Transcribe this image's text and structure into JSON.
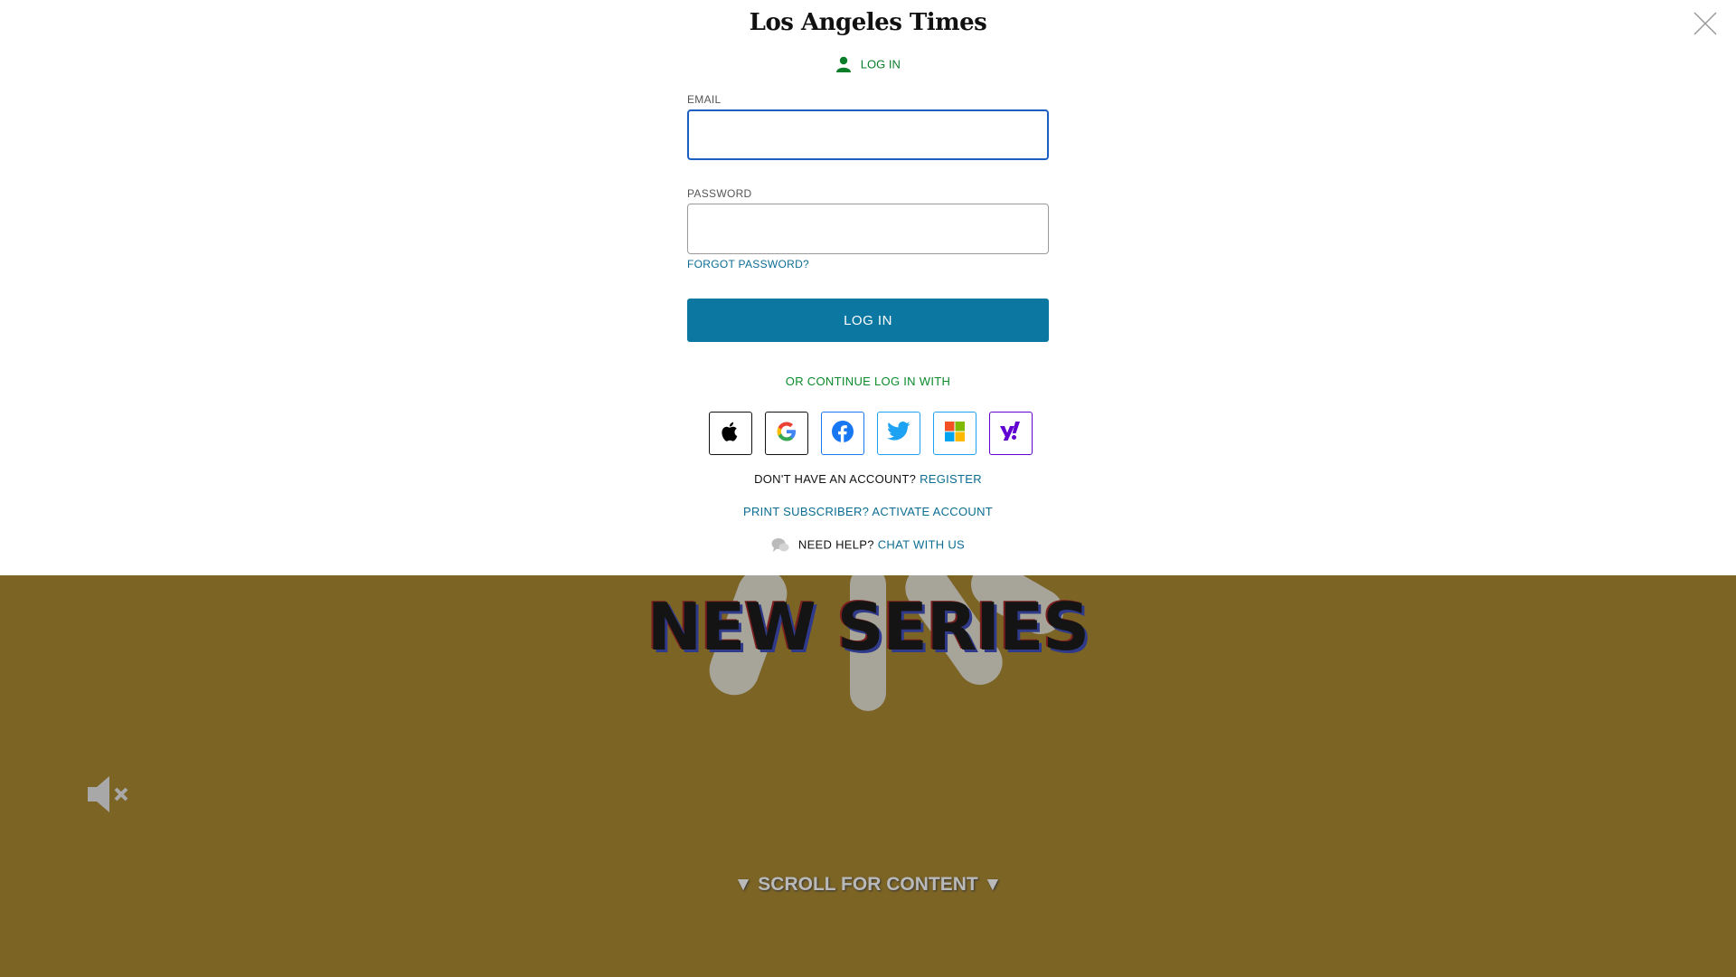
{
  "modal": {
    "logo": "Los Angeles Times",
    "heading": "LOG IN",
    "email_label": "EMAIL",
    "email_value": "",
    "password_label": "PASSWORD",
    "password_value": "",
    "forgot_password": "FORGOT PASSWORD?",
    "login_button": "LOG IN",
    "continue_with": "OR CONTINUE LOG IN WITH",
    "socials": [
      "apple-icon",
      "google-icon",
      "facebook-icon",
      "twitter-icon",
      "microsoft-icon",
      "yahoo-icon"
    ],
    "register_prompt": "DON'T HAVE AN ACCOUNT?",
    "register_link": "REGISTER",
    "print_subscriber": "PRINT SUBSCRIBER? ACTIVATE ACCOUNT",
    "help_prompt": "NEED HELP?",
    "help_link": "CHAT WITH US"
  },
  "background": {
    "title": "NEW SERIES",
    "scroll_cue": "▼ SCROLL FOR CONTENT ▼"
  },
  "colors": {
    "accent_button": "#0c77a0",
    "link": "#0b6d92",
    "green": "#0a7d2a",
    "backdrop": "#7c6425"
  }
}
